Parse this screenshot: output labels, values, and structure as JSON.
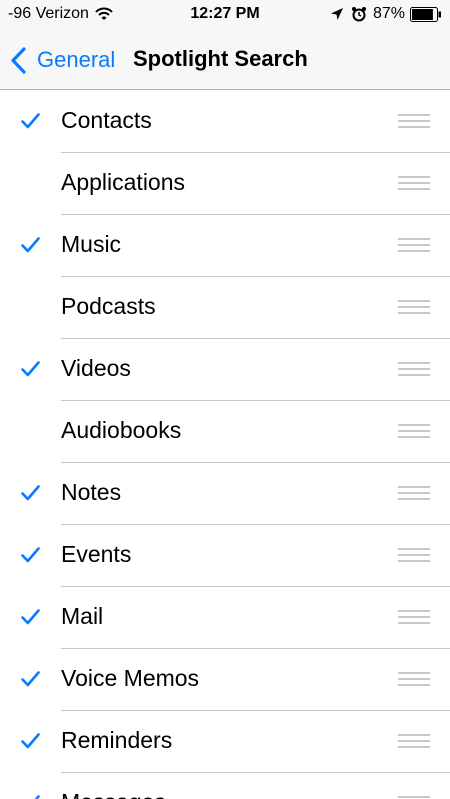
{
  "status_bar": {
    "carrier": "-96 Verizon",
    "time": "12:27 PM",
    "battery_percent": "87%",
    "battery_level": 0.87,
    "icons": [
      "wifi-icon",
      "location-arrow-icon",
      "alarm-clock-icon",
      "battery-icon"
    ]
  },
  "nav": {
    "back_label": "General",
    "title": "Spotlight Search"
  },
  "colors": {
    "accent": "#0a7aff",
    "separator": "#c8c7cc",
    "bar_background": "#f7f7f7"
  },
  "items": [
    {
      "label": "Contacts",
      "checked": true
    },
    {
      "label": "Applications",
      "checked": false
    },
    {
      "label": "Music",
      "checked": true
    },
    {
      "label": "Podcasts",
      "checked": false
    },
    {
      "label": "Videos",
      "checked": true
    },
    {
      "label": "Audiobooks",
      "checked": false
    },
    {
      "label": "Notes",
      "checked": true
    },
    {
      "label": "Events",
      "checked": true
    },
    {
      "label": "Mail",
      "checked": true
    },
    {
      "label": "Voice Memos",
      "checked": true
    },
    {
      "label": "Reminders",
      "checked": true
    },
    {
      "label": "Messages",
      "checked": true
    }
  ]
}
